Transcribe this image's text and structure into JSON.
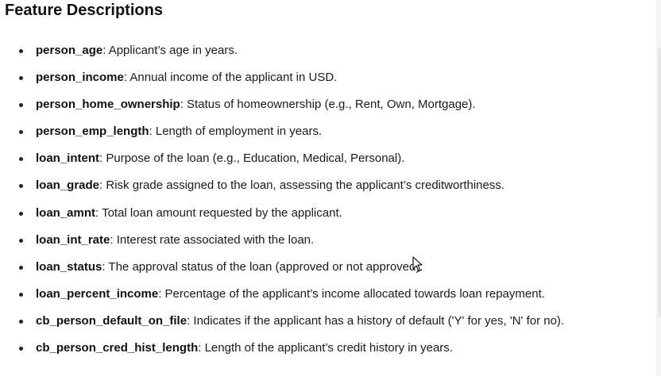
{
  "title": "Feature Descriptions",
  "features": [
    {
      "term": "person_age",
      "desc": ": Applicant’s age in years."
    },
    {
      "term": "person_income",
      "desc": ": Annual income of the applicant in USD."
    },
    {
      "term": "person_home_ownership",
      "desc": ": Status of homeownership (e.g., Rent, Own, Mortgage)."
    },
    {
      "term": "person_emp_length",
      "desc": ": Length of employment in years."
    },
    {
      "term": "loan_intent",
      "desc": ": Purpose of the loan (e.g., Education, Medical, Personal)."
    },
    {
      "term": "loan_grade",
      "desc": ": Risk grade assigned to the loan, assessing the applicant’s creditworthiness."
    },
    {
      "term": "loan_amnt",
      "desc": ": Total loan amount requested by the applicant."
    },
    {
      "term": "loan_int_rate",
      "desc": ": Interest rate associated with the loan."
    },
    {
      "term": "loan_status",
      "desc": ": The approval status of the loan (approved or not approved)."
    },
    {
      "term": "loan_percent_income",
      "desc": ": Percentage of the applicant’s income allocated towards loan repayment."
    },
    {
      "term": "cb_person_default_on_file",
      "desc": ": Indicates if the applicant has a history of default ('Y' for yes, 'N' for no)."
    },
    {
      "term": "cb_person_cred_hist_length",
      "desc": ": Length of the applicant’s credit history in years."
    }
  ]
}
